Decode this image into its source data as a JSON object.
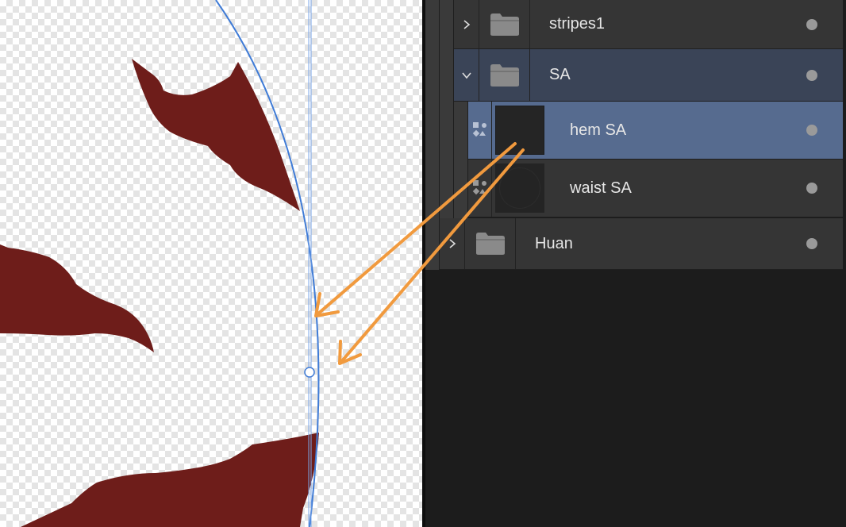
{
  "canvas": {
    "shape_color": "#6e1d1a",
    "curve_color": "#3f7bd6",
    "guide_color": "#7aa6e8",
    "background_pattern": "transparency-checkerboard"
  },
  "annotation": {
    "arrow_color": "#f19a3e",
    "count": 2
  },
  "layers": {
    "selected_color": "#566b8f",
    "group_color": "#3a4457",
    "rows": [
      {
        "name": "stripes1",
        "kind": "group",
        "expander": "chevron-right-icon",
        "visible": true
      },
      {
        "name": "SA",
        "kind": "group",
        "expander": "chevron-down-icon",
        "visible": true,
        "expanded": true
      },
      {
        "name": "hem SA",
        "kind": "layer",
        "selected": true,
        "visible": true
      },
      {
        "name": "waist SA",
        "kind": "layer",
        "visible": true
      },
      {
        "name": "Huan",
        "kind": "group",
        "expander": "chevron-right-icon",
        "visible": true
      }
    ]
  }
}
